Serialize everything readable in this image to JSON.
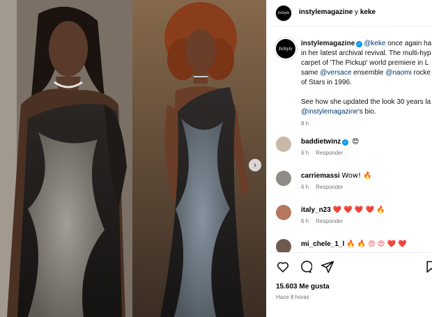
{
  "header": {
    "avatar_text": "InStyle",
    "account": "instylemagazine",
    "connector": " y ",
    "collaborator": "keke"
  },
  "caption": {
    "avatar_text": "InStyle",
    "username": "instylemagazine",
    "lines": {
      "l1_mention": "@keke",
      "l1_text": " once again ha",
      "l2": "in her latest archival revival. The multi-hyp",
      "l3": "carpet of 'The Pickup' world premiere in L",
      "l4_pre": "same ",
      "l4_mention1": "@versace",
      "l4_mid": " ensemble ",
      "l4_mention2": "@naomi",
      "l4_post": " rocke",
      "l5": "of Stars in 1996.",
      "l6": "See how she updated the look 30 years la",
      "l7_mention": "@instylemagazine",
      "l7_text": "'s bio."
    },
    "time": "8 h"
  },
  "comments": [
    {
      "username": "baddietwinz",
      "verified": true,
      "text": "😍",
      "time": "6 h",
      "reply": "Responder"
    },
    {
      "username": "carriemassi",
      "verified": false,
      "text": "Wow! 🔥",
      "time": "6 h",
      "reply": "Responder"
    },
    {
      "username": "italy_n23",
      "verified": false,
      "text": "❤️ ❤️ ❤️ ❤️ 🔥",
      "time": "6 h",
      "reply": "Responder"
    },
    {
      "username": "mi_chele_1_l",
      "verified": false,
      "text": "🔥 🔥 😍 😍 ❤️ ❤️",
      "time": "",
      "reply": ""
    }
  ],
  "footer": {
    "likes": "15.603 Me gusta",
    "posted": "Hace 8 horas"
  },
  "icons": {
    "like": "heart-icon",
    "comment": "comment-icon",
    "share": "share-icon",
    "save": "bookmark-icon",
    "next": "chevron-right-icon"
  },
  "colors": {
    "link": "#00376b",
    "verified": "#0095f6",
    "muted": "#737373"
  }
}
